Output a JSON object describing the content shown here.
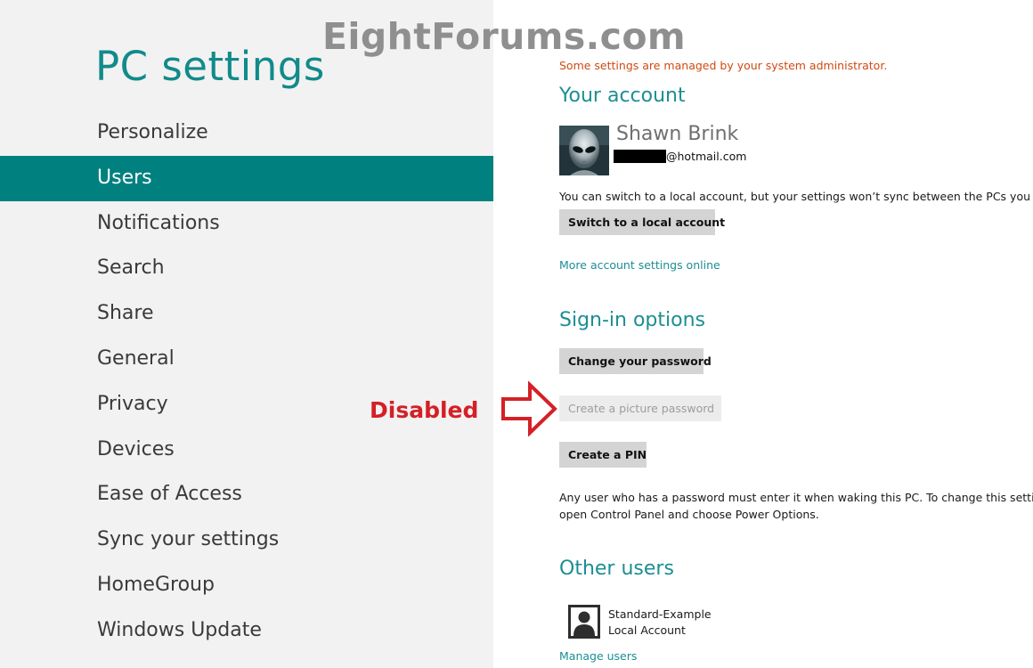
{
  "watermark": "EightForums.com",
  "app": {
    "title": "PC settings"
  },
  "nav": {
    "items": [
      {
        "label": "Personalize",
        "selected": false
      },
      {
        "label": "Users",
        "selected": true
      },
      {
        "label": "Notifications",
        "selected": false
      },
      {
        "label": "Search",
        "selected": false
      },
      {
        "label": "Share",
        "selected": false
      },
      {
        "label": "General",
        "selected": false
      },
      {
        "label": "Privacy",
        "selected": false
      },
      {
        "label": "Devices",
        "selected": false
      },
      {
        "label": "Ease of Access",
        "selected": false
      },
      {
        "label": "Sync your settings",
        "selected": false
      },
      {
        "label": "HomeGroup",
        "selected": false
      },
      {
        "label": "Windows Update",
        "selected": false
      }
    ]
  },
  "annotation": {
    "label": "Disabled",
    "color": "#d42026"
  },
  "content": {
    "admin_notice": "Some settings are managed by your system administrator.",
    "your_account": {
      "heading": "Your account",
      "user_name": "Shawn Brink",
      "email_domain": "@hotmail.com",
      "sync_note": "You can switch to a local account, but your settings won’t sync between the PCs you use.",
      "switch_button": "Switch to a local account",
      "more_link": "More account settings online"
    },
    "signin_options": {
      "heading": "Sign-in options",
      "change_password_button": "Change your password",
      "picture_password_button": "Create a picture password",
      "picture_password_disabled": true,
      "pin_button": "Create a PIN",
      "power_note_line1": "Any user who has a password must enter it when waking this PC. To change this setting,",
      "power_note_line2": "open Control Panel and choose Power Options."
    },
    "other_users": {
      "heading": "Other users",
      "users": [
        {
          "name": "Standard-Example",
          "type": "Local Account",
          "icon": "user-silhouette-icon"
        }
      ],
      "manage_link": "Manage users"
    }
  },
  "colors": {
    "accent": "#00807f",
    "heading": "#1c8e94",
    "notice": "#d04a12",
    "left_pane_bg": "#f2f2f2",
    "button_bg": "#d4d4d4",
    "button_disabled_bg": "#ececec"
  }
}
